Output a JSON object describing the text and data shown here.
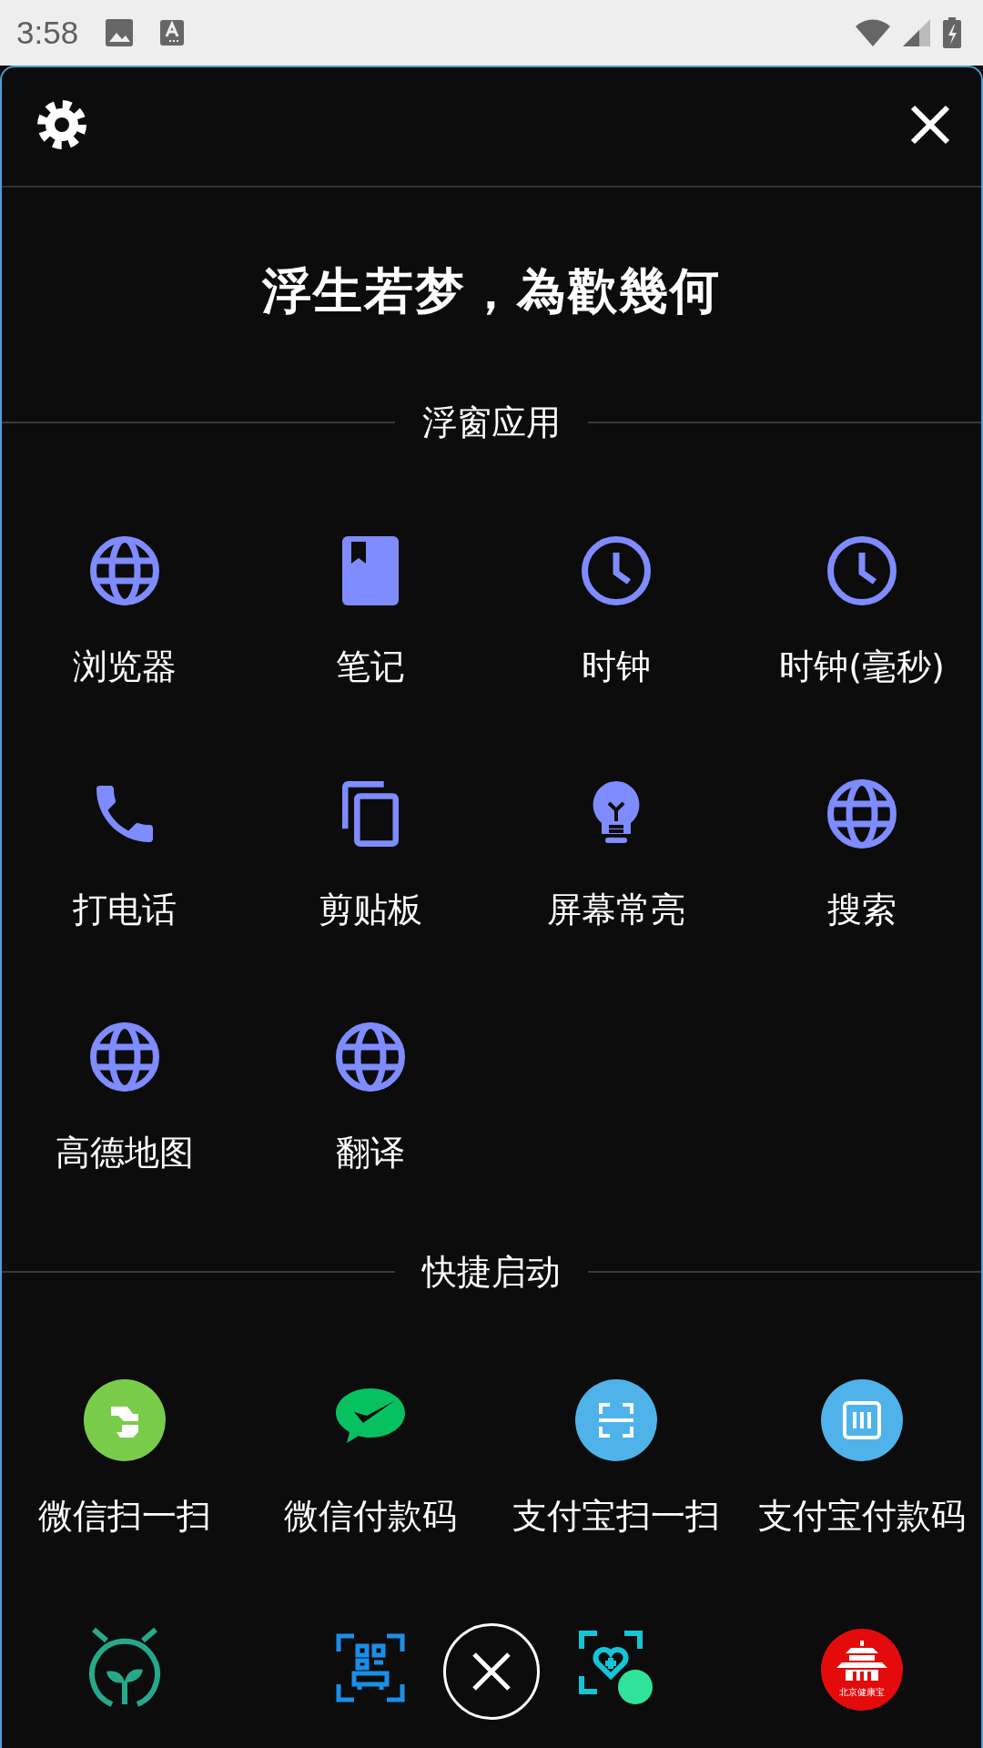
{
  "status_bar": {
    "time": "3:58"
  },
  "banner": {
    "text": "浮生若梦，為歡幾何"
  },
  "sections": [
    {
      "title": "浮窗应用",
      "apps": [
        {
          "label": "浏览器"
        },
        {
          "label": "笔记"
        },
        {
          "label": "时钟"
        },
        {
          "label": "时钟(毫秒)"
        },
        {
          "label": "打电话"
        },
        {
          "label": "剪贴板"
        },
        {
          "label": "屏幕常亮"
        },
        {
          "label": "搜索"
        },
        {
          "label": "高德地图"
        },
        {
          "label": "翻译"
        }
      ]
    },
    {
      "title": "快捷启动",
      "apps": [
        {
          "label": "微信扫一扫"
        },
        {
          "label": "微信付款码"
        },
        {
          "label": "支付宝扫一扫"
        },
        {
          "label": "支付宝付款码"
        }
      ]
    }
  ],
  "dock": {
    "badge_text": "北京健康宝"
  }
}
